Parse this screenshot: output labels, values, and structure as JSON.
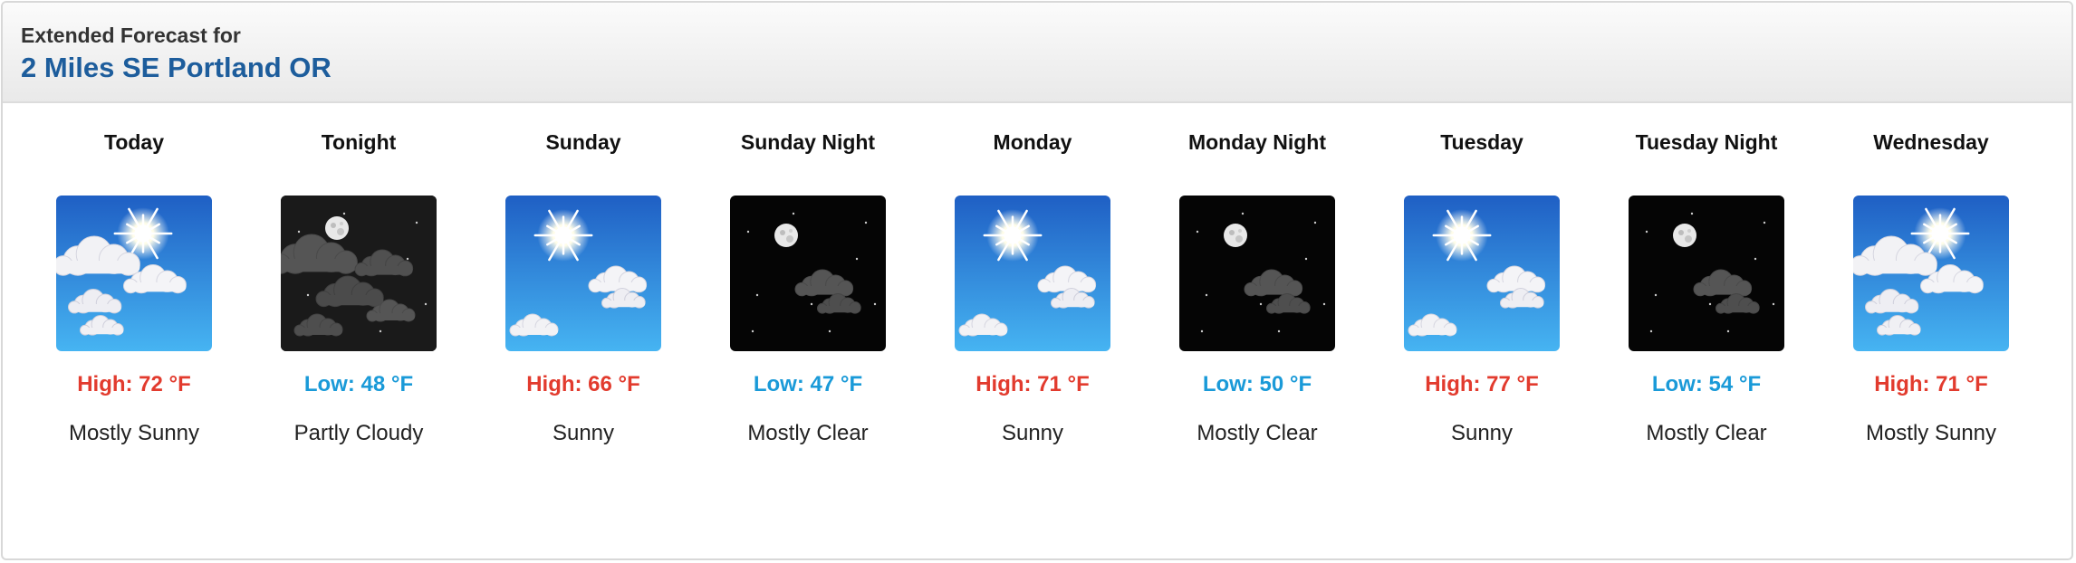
{
  "header": {
    "subtitle": "Extended Forecast for",
    "location": "2 Miles SE Portland OR"
  },
  "colors": {
    "high": "#e23b2e",
    "low": "#1a9ad8",
    "location": "#1d5d9c"
  },
  "periods": [
    {
      "name": "Today",
      "temp": "High: 72 °F",
      "kind": "high",
      "desc": "Mostly Sunny",
      "icon": "mostly-sunny-icon"
    },
    {
      "name": "Tonight",
      "temp": "Low: 48 °F",
      "kind": "low",
      "desc": "Partly Cloudy",
      "icon": "partly-cloudy-night-icon"
    },
    {
      "name": "Sunday",
      "temp": "High: 66 °F",
      "kind": "high",
      "desc": "Sunny",
      "icon": "sunny-icon"
    },
    {
      "name": "Sunday Night",
      "temp": "Low: 47 °F",
      "kind": "low",
      "desc": "Mostly Clear",
      "icon": "mostly-clear-night-icon"
    },
    {
      "name": "Monday",
      "temp": "High: 71 °F",
      "kind": "high",
      "desc": "Sunny",
      "icon": "sunny-icon"
    },
    {
      "name": "Monday Night",
      "temp": "Low: 50 °F",
      "kind": "low",
      "desc": "Mostly Clear",
      "icon": "mostly-clear-night-icon"
    },
    {
      "name": "Tuesday",
      "temp": "High: 77 °F",
      "kind": "high",
      "desc": "Sunny",
      "icon": "sunny-icon"
    },
    {
      "name": "Tuesday Night",
      "temp": "Low: 54 °F",
      "kind": "low",
      "desc": "Mostly Clear",
      "icon": "mostly-clear-night-icon"
    },
    {
      "name": "Wednesday",
      "temp": "High: 71 °F",
      "kind": "high",
      "desc": "Mostly Sunny",
      "icon": "mostly-sunny-icon"
    }
  ]
}
